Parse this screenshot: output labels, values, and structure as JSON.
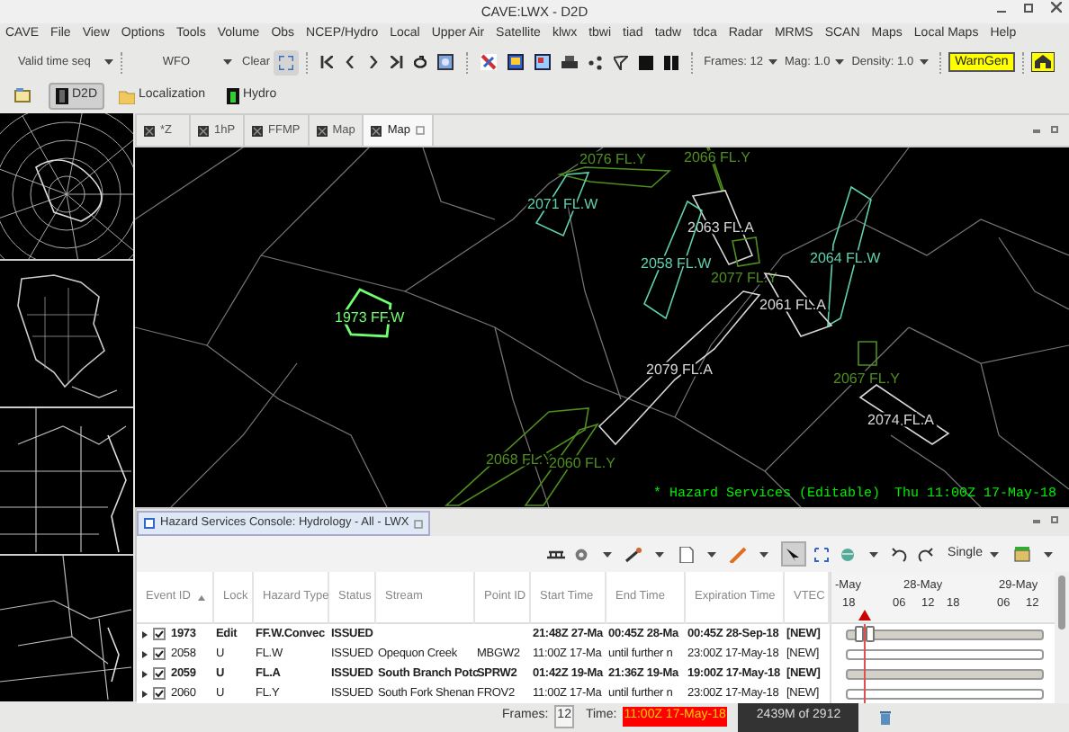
{
  "window": {
    "title": "CAVE:LWX - D2D"
  },
  "menu": [
    "CAVE",
    "File",
    "View",
    "Options",
    "Tools",
    "Volume",
    "Obs",
    "NCEP/Hydro",
    "Local",
    "Upper Air",
    "Satellite",
    "klwx",
    "tbwi",
    "tiad",
    "tadw",
    "tdca",
    "Radar",
    "MRMS",
    "SCAN",
    "Maps",
    "Local Maps",
    "Help"
  ],
  "toolbar": {
    "time_mode": "Valid time seq",
    "scale": "WFO",
    "clear": "Clear",
    "frames": "Frames: 12",
    "mag": "Mag: 1.0",
    "density": "Density: 1.0",
    "warngen": "WarnGen"
  },
  "perspectives": [
    {
      "label": "D2D",
      "selected": true
    },
    {
      "label": "Localization",
      "selected": false
    },
    {
      "label": "Hydro",
      "selected": false
    }
  ],
  "editor_tabs": [
    {
      "label": "*Z",
      "selected": false
    },
    {
      "label": "1hP",
      "selected": false
    },
    {
      "label": "FFMP",
      "selected": false
    },
    {
      "label": "Map",
      "selected": false
    },
    {
      "label": "Map",
      "selected": true
    }
  ],
  "map": {
    "hazards": [
      {
        "label": "2076 FL.Y",
        "kind": "advisory"
      },
      {
        "label": "2066 FL.Y",
        "kind": "advisory"
      },
      {
        "label": "2071 FL.W",
        "kind": "warning"
      },
      {
        "label": "2063 FL.A",
        "kind": "watch"
      },
      {
        "label": "2058 FL.W",
        "kind": "warning"
      },
      {
        "label": "2064 FL.W",
        "kind": "warning"
      },
      {
        "label": "2077 FL.Y",
        "kind": "advisory"
      },
      {
        "label": "2061 FL.A",
        "kind": "watch"
      },
      {
        "label": "1973 FF.W",
        "kind": "flash"
      },
      {
        "label": "2079 FL.A",
        "kind": "watch"
      },
      {
        "label": "2067 FL.Y",
        "kind": "advisory"
      },
      {
        "label": "2074 FL.A",
        "kind": "watch"
      },
      {
        "label": "2068 FL.Y",
        "kind": "advisory"
      },
      {
        "label": "2060 FL.Y",
        "kind": "advisory"
      }
    ],
    "legend": "* Hazard Services (Editable)",
    "time": "Thu 11:00Z 17-May-18"
  },
  "console": {
    "title": "Hazard Services Console: Hydrology - All - LWX",
    "mode": "Single",
    "columns": [
      "Event ID",
      "Lock",
      "Hazard Type",
      "Status",
      "Stream",
      "Point ID",
      "Start Time",
      "End Time",
      "Expiration Time",
      "VTEC"
    ],
    "timeline": {
      "days": [
        "-May",
        "28-May",
        "29-May"
      ],
      "hours": [
        "18",
        "06",
        "12",
        "18",
        "06",
        "12"
      ]
    },
    "rows": [
      {
        "cells": [
          "1973",
          "Edit",
          "FF.W.Convec",
          "ISSUED",
          "",
          "",
          "21:48Z 27-Ma",
          "00:45Z 28-Ma",
          "00:45Z 28-Sep-18",
          "[NEW]"
        ],
        "checked": true,
        "bold": true,
        "kind": "shaded",
        "handles": true
      },
      {
        "cells": [
          "2058",
          "U",
          "FL.W",
          "ISSUED",
          "Opequon Creek",
          "MBGW2",
          "11:00Z 17-Ma",
          "until further n",
          "23:00Z 17-May-18",
          "[NEW]"
        ],
        "checked": true,
        "bold": false,
        "kind": "plain",
        "handles": false
      },
      {
        "cells": [
          "2059",
          "U",
          "FL.A",
          "ISSUED",
          "South Branch Potc",
          "SPRW2",
          "01:42Z 19-Ma",
          "21:36Z 19-Ma",
          "19:00Z 17-May-18",
          "[NEW]"
        ],
        "checked": true,
        "bold": true,
        "kind": "shaded",
        "handles": false
      },
      {
        "cells": [
          "2060",
          "U",
          "FL.Y",
          "ISSUED",
          "South Fork Shenan",
          "FROV2",
          "11:00Z 17-Ma",
          "until further n",
          "23:00Z 17-May-18",
          "[NEW]"
        ],
        "checked": true,
        "bold": false,
        "kind": "plain",
        "handles": false
      }
    ]
  },
  "status_bar": {
    "frames_label": "Frames:",
    "frames": "12",
    "time_label": "Time:",
    "time": "11:00Z 17-May-18",
    "memory": "2439M of 2912"
  }
}
